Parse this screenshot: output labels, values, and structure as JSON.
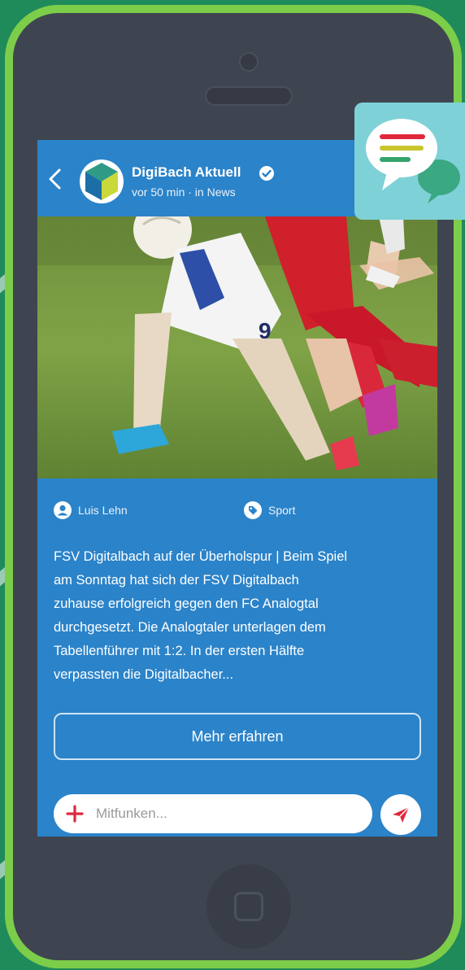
{
  "header": {
    "back_icon": "chevron-left-icon",
    "avatar_icon": "cube-logo-icon",
    "title": "DigiBach Aktuell",
    "verified_icon": "verified-check-icon",
    "meta": "vor 50 min · in News"
  },
  "article": {
    "image_desc": "soccer-players-photo",
    "author": "Luis Lehn",
    "author_icon": "user-circle-icon",
    "category": "Sport",
    "category_icon": "tag-icon",
    "text_lines": [
      "FSV Digitalbach auf der Überholspur | Beim Spiel",
      "am Sonntag hat sich der FSV Digitalbach",
      "zuhause erfolgreich gegen den FC Analogtal",
      "durchgesetzt. Die Analogtaler unterlagen dem",
      "Tabellenführer mit 1:2. In der ersten Hälfte",
      "verpassten die Digitalbacher..."
    ],
    "more_label": "Mehr erfahren"
  },
  "comment": {
    "plus_icon": "plus-icon",
    "placeholder": "Mitfunken...",
    "send_icon": "paper-plane-icon"
  },
  "badge": {
    "icon": "chat-bubbles-icon"
  },
  "colors": {
    "background": "#1f8a5a",
    "phone_frame": "#7ccd4a",
    "phone_body": "#3f4550",
    "screen": "#2b83c9",
    "accent_red": "#e0283c",
    "badge": "#7fd1d8"
  }
}
